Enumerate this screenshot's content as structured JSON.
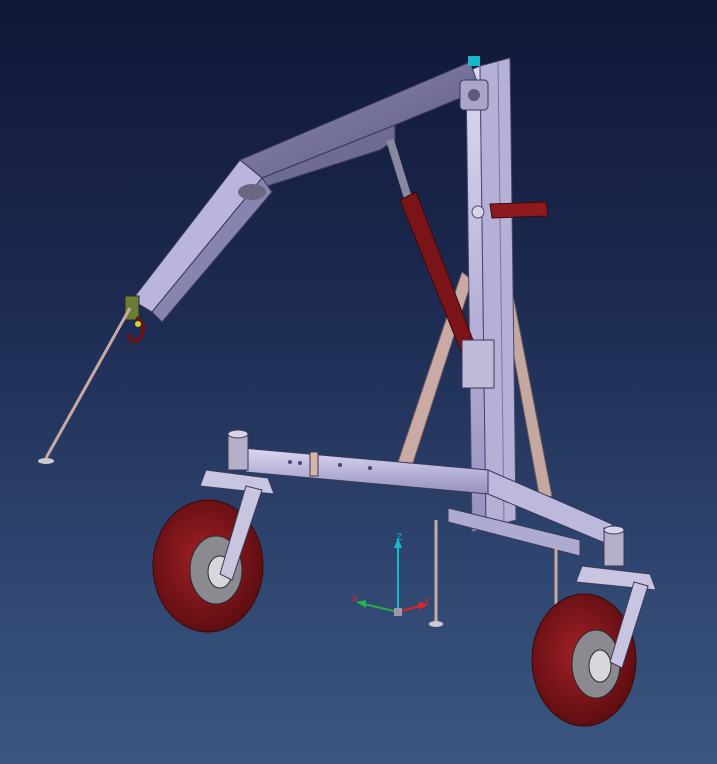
{
  "viewport": {
    "background_top": "#0f1735",
    "background_bottom": "#3a5680"
  },
  "model": {
    "frame_color": "#c9c6e6",
    "frame_shade": "#8c88b4",
    "cylinder_color": "#7a1418",
    "tire_color": "#8a1a1e",
    "hub_color": "#b8b8bc",
    "leg_color": "#c2a6a0"
  },
  "compass": {
    "z_label": "Z",
    "x_label": "X",
    "y_label": "Y",
    "z_color": "#19b7c9",
    "x_color": "#e02424",
    "y_color": "#22b14c"
  }
}
